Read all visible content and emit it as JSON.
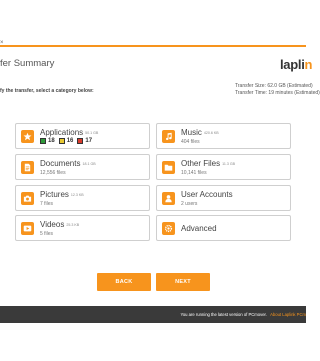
{
  "window": {
    "close_glyph": "×"
  },
  "header": {
    "title": "fer Summary",
    "logo_main": "lapli",
    "logo_accent": "n"
  },
  "transfer": {
    "size_line": "Transfer Size: 62.0 GB (Estimated)",
    "time_line": "Transfer Time: 19 minutes (Estimated)"
  },
  "instruction": "fy the transfer, select a category below:",
  "categories": {
    "applications": {
      "label": "Applications",
      "size": "50.1 GB",
      "badges": [
        {
          "count": "18",
          "color": "#2e9a3a"
        },
        {
          "count": "16",
          "color": "#e8c832"
        },
        {
          "count": "17",
          "color": "#d93a2b"
        }
      ],
      "icon": "star-icon"
    },
    "music": {
      "label": "Music",
      "size": "420.6 KB",
      "sub": "404 files",
      "icon": "music-note-icon"
    },
    "documents": {
      "label": "Documents",
      "size": "18.1 GB",
      "sub": "12,556 files",
      "icon": "document-icon"
    },
    "other_files": {
      "label": "Other Files",
      "size": "11.3 GB",
      "sub": "10,141 files",
      "icon": "folder-icon"
    },
    "pictures": {
      "label": "Pictures",
      "size": "12.3 KB",
      "sub": "7 files",
      "icon": "camera-icon"
    },
    "user_accounts": {
      "label": "User Accounts",
      "size": "",
      "sub": "2 users",
      "icon": "user-icon"
    },
    "videos": {
      "label": "Videos",
      "size": "25.3 KB",
      "sub": "5 files",
      "icon": "video-play-icon"
    },
    "advanced": {
      "label": "Advanced",
      "size": "",
      "sub": "",
      "icon": "gear-icon"
    }
  },
  "buttons": {
    "back": "BACK",
    "next": "NEXT"
  },
  "footer": {
    "text": "You are running the latest version of PCmover.",
    "link": "About Laplink PCm"
  },
  "colors": {
    "accent": "#f7941d",
    "footer_bg": "#3a3a3a"
  }
}
